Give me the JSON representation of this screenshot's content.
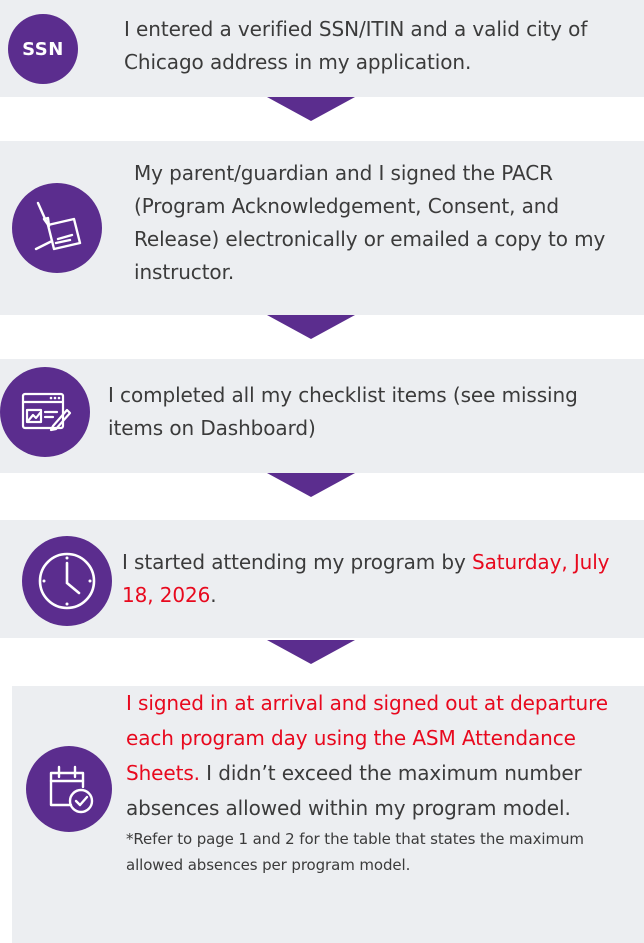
{
  "steps": [
    {
      "icon_name": "ssn-badge-icon",
      "icon_text": "SSN",
      "text": "I entered a verified SSN/ITIN and a valid city of Chicago address in my application."
    },
    {
      "icon_name": "signature-document-icon",
      "text": "My parent/guardian and I signed the PACR (Program Acknowledgement, Consent, and Release) electronically or emailed a copy to my instructor."
    },
    {
      "icon_name": "checklist-window-icon",
      "text": "I completed all my checklist items (see missing items on Dashboard)"
    },
    {
      "icon_name": "clock-icon",
      "text_prefix": "I started attending my program by ",
      "text_highlight": "Saturday, July 18, 2026",
      "text_suffix": "."
    },
    {
      "icon_name": "calendar-check-icon",
      "text_highlight": "I signed in at arrival and signed out at departure each program day using the ASM Attendance Sheets.",
      "text_rest": " I didn’t exceed the maximum number absences allowed within my program model.",
      "note": "*Refer to page 1 and 2 for the table that states the maximum allowed absences per program model."
    }
  ],
  "colors": {
    "accent": "#5b2d8e",
    "highlight": "#e8091e",
    "box_bg": "#eceef1"
  }
}
